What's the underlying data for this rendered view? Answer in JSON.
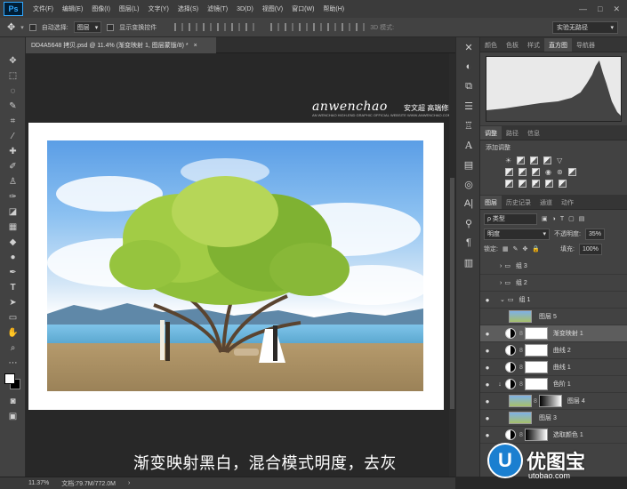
{
  "app": {
    "logo": "Ps"
  },
  "menubar": {
    "items": [
      "文件(F)",
      "编辑(E)",
      "图像(I)",
      "图层(L)",
      "文字(Y)",
      "选择(S)",
      "滤镜(T)",
      "3D(D)",
      "视图(V)",
      "窗口(W)",
      "帮助(H)"
    ],
    "controls": [
      "—",
      "□",
      "✕"
    ]
  },
  "options": {
    "auto_select_label": "自动选择:",
    "auto_select_value": "图层",
    "show_transform_label": "显示变换控件",
    "mode_label": "3D 模式:",
    "workspace": "实验无路径"
  },
  "document": {
    "tab_title": "DD4A5648 拷贝.psd @ 11.4% (渐变映射 1, 图层蒙版/8) *",
    "tab_close": "×",
    "watermark": "anwenchao",
    "watermark_cn": "安文超 高端修图",
    "watermark_sub": "AN WENCHAO HIGH-END GRAPHIC OFFICIAL WEBSITE WWW.ANWENCHAO.COM",
    "caption": "渐变映射黑白，混合模式明度，去灰"
  },
  "status": {
    "zoom": "11.37%",
    "doc_size": "文档:79.7M/772.0M"
  },
  "panels": {
    "top_tabs": [
      "颜色",
      "色板",
      "样式",
      "直方图",
      "导航器"
    ],
    "top_active": 3,
    "adjust_tabs": [
      "调整",
      "路径",
      "信息"
    ],
    "adjust_title": "添加调整",
    "layer_tabs": [
      "图层",
      "历史记录",
      "通道",
      "动作"
    ],
    "kind_label": "ρ 类型",
    "blend_mode": "明度",
    "opacity_label": "不透明度:",
    "opacity_value": "35%",
    "lock_label": "锁定:",
    "fill_label": "填充:",
    "fill_value": "100%",
    "layers": [
      {
        "name": "组 3",
        "type": "group",
        "visible": false
      },
      {
        "name": "组 2",
        "type": "group",
        "visible": false
      },
      {
        "name": "组 1",
        "type": "group-open",
        "visible": true
      },
      {
        "name": "图层 5",
        "type": "image",
        "visible": false
      },
      {
        "name": "渐变映射 1",
        "type": "adjustment",
        "visible": true,
        "active": true
      },
      {
        "name": "曲线 2",
        "type": "adjustment",
        "visible": true
      },
      {
        "name": "曲线 1",
        "type": "adjustment",
        "visible": true
      },
      {
        "name": "色阶 1",
        "type": "adjustment",
        "visible": true
      },
      {
        "name": "图层 4",
        "type": "image",
        "visible": true
      },
      {
        "name": "图层 3",
        "type": "image",
        "visible": true
      },
      {
        "name": "选取颜色 1",
        "type": "adjustment",
        "visible": true
      }
    ]
  },
  "brand": {
    "name": "优图宝",
    "url": "utobao.com"
  }
}
